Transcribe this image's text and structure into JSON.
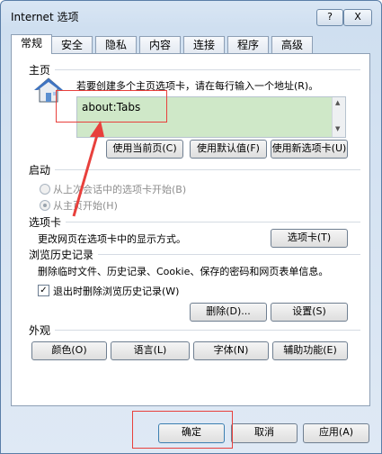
{
  "window": {
    "title": "Internet 选项",
    "help_label": "?",
    "close_label": "X"
  },
  "tabs": [
    "常规",
    "安全",
    "隐私",
    "内容",
    "连接",
    "程序",
    "高级"
  ],
  "homepage": {
    "section_title": "主页",
    "description": "若要创建多个主页选项卡，请在每行输入一个地址(R)。",
    "url_value": "about:Tabs",
    "buttons": {
      "use_current": "使用当前页(C)",
      "use_default": "使用默认值(F)",
      "use_new_tab": "使用新选项卡(U)"
    }
  },
  "startup": {
    "section_title": "启动",
    "option_last_session": "从上次会话中的选项卡开始(B)",
    "option_home": "从主页开始(H)"
  },
  "tabs_section": {
    "section_title": "选项卡",
    "description": "更改网页在选项卡中的显示方式。",
    "button": "选项卡(T)"
  },
  "history": {
    "section_title": "浏览历史记录",
    "description": "删除临时文件、历史记录、Cookie、保存的密码和网页表单信息。",
    "checkbox_label": "退出时删除浏览历史记录(W)",
    "checkbox_checked": true,
    "delete_button": "删除(D)...",
    "settings_button": "设置(S)"
  },
  "appearance": {
    "section_title": "外观",
    "colors_button": "颜色(O)",
    "languages_button": "语言(L)",
    "fonts_button": "字体(N)",
    "accessibility_button": "辅助功能(E)"
  },
  "footer": {
    "ok_button": "确定",
    "cancel_button": "取消",
    "apply_button": "应用(A)"
  }
}
